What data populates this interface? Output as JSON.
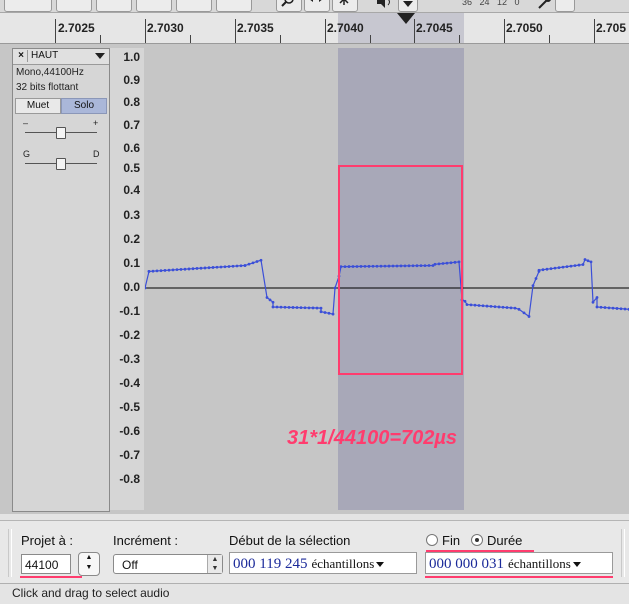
{
  "ruler": {
    "ticks": [
      "2.7025",
      "2.7030",
      "2.7035",
      "2.7040",
      "2.7045",
      "2.7050",
      "2.705"
    ]
  },
  "toolbar": {
    "zoom_icon": "zoom-icon",
    "timeshift_icon": "time-shift-icon",
    "multi_icon": "multi-tool-icon",
    "speaker_icon": "speaker-icon",
    "mic_icon": "microphone-icon"
  },
  "track": {
    "name": "HAUT",
    "close_label": "×",
    "format": "Mono,44100Hz",
    "bit_depth": "32 bits flottant",
    "mute_label": "Muet",
    "solo_label": "Solo",
    "gain_minus": "–",
    "gain_plus": "+",
    "pan_left": "G",
    "pan_right": "D"
  },
  "scale": {
    "labels": [
      "1.0",
      "0.9",
      "0.8",
      "0.7",
      "0.6",
      "0.5",
      "0.4",
      "0.3",
      "0.2",
      "0.1",
      "0.0",
      "-0.1",
      "-0.2",
      "-0.3",
      "-0.4",
      "-0.5",
      "-0.6",
      "-0.7",
      "-0.8"
    ]
  },
  "annotation": {
    "text": "31*1/44100=702µs"
  },
  "selection_toolbar": {
    "project_rate_label": "Projet à :",
    "project_rate_value": "44100",
    "snap_label": "Incrément :",
    "snap_value": "Off",
    "sel_start_label": "Début de la sélection",
    "sel_start_value": "000 119 245",
    "sel_start_unit": "échantillons",
    "end_label": "Fin",
    "duration_label": "Durée",
    "duration_selected": true,
    "duration_value": "000 000 031",
    "duration_unit": "échantillons"
  },
  "status": {
    "text": "Click and drag to select audio"
  },
  "colors": {
    "waveform": "#3b4fd8",
    "selection": "#a8a8b8",
    "annotation": "#ff3c6e",
    "solo_button": "#aab7d9"
  }
}
